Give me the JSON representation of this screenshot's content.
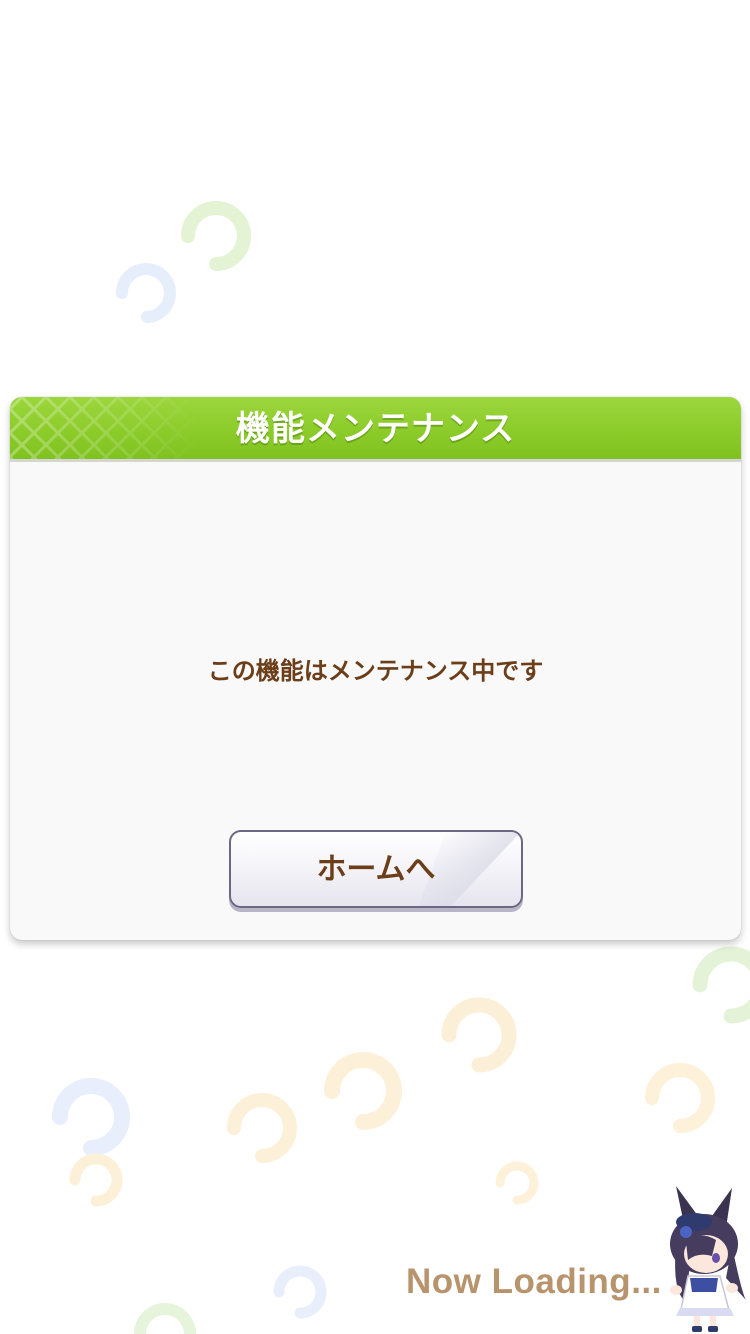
{
  "dialog": {
    "title": "機能メンテナンス",
    "message": "この機能はメンテナンス中です",
    "home_button_label": "ホームへ"
  },
  "loading": {
    "text": "Now Loading..."
  },
  "colors": {
    "header_green": "#8ccc2a",
    "text_brown": "#6b3d18",
    "loading_tan": "#b8946d",
    "button_border": "#6c6884"
  },
  "icons": [
    "horseshoe-icon",
    "mascot-character"
  ]
}
